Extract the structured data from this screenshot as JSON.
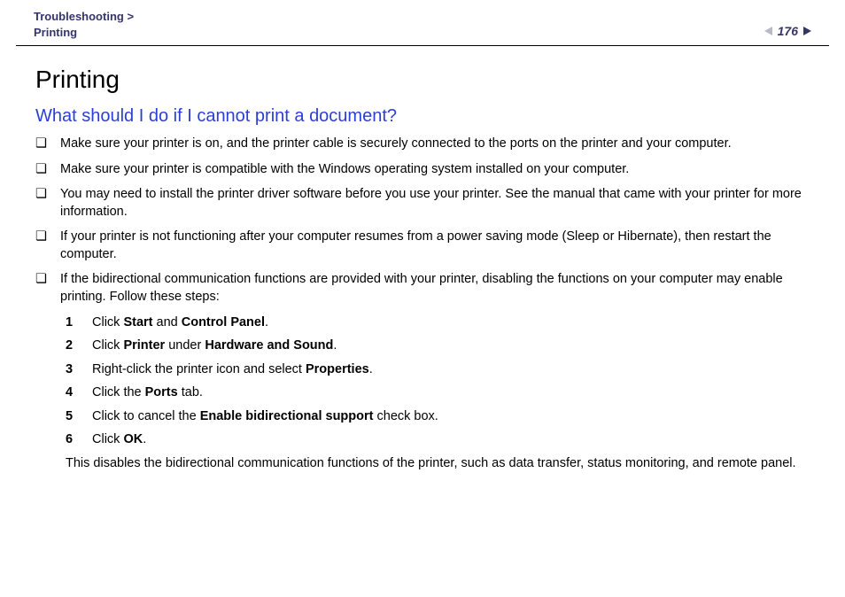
{
  "header": {
    "breadcrumb_top": "Troubleshooting",
    "breadcrumb_sep": ">",
    "breadcrumb_bottom": "Printing",
    "page_number": "176"
  },
  "content": {
    "title": "Printing",
    "subhead": "What should I do if I cannot print a document?",
    "bullets": [
      {
        "text": "Make sure your printer is on, and the printer cable is securely connected to the ports on the printer and your computer."
      },
      {
        "text": "Make sure your printer is compatible with the Windows operating system installed on your computer."
      },
      {
        "text": "You may need to install the printer driver software before you use your printer. See the manual that came with your printer for more information."
      },
      {
        "text": "If your printer is not functioning after your computer resumes from a power saving mode (Sleep or Hibernate), then restart the computer."
      },
      {
        "text": "If the bidirectional communication functions are provided with your printer, disabling the functions on your computer may enable printing. Follow these steps:"
      }
    ],
    "steps": [
      {
        "num": "1",
        "pre": "Click ",
        "b1": "Start",
        "mid": " and ",
        "b2": "Control Panel",
        "post": "."
      },
      {
        "num": "2",
        "pre": "Click ",
        "b1": "Printer",
        "mid": " under ",
        "b2": "Hardware and Sound",
        "post": "."
      },
      {
        "num": "3",
        "pre": "Right-click the printer icon and select ",
        "b1": "Properties",
        "mid": "",
        "b2": "",
        "post": "."
      },
      {
        "num": "4",
        "pre": "Click the ",
        "b1": "Ports",
        "mid": "",
        "b2": "",
        "post": " tab."
      },
      {
        "num": "5",
        "pre": "Click to cancel the ",
        "b1": "Enable bidirectional support",
        "mid": "",
        "b2": "",
        "post": " check box."
      },
      {
        "num": "6",
        "pre": "Click ",
        "b1": "OK",
        "mid": "",
        "b2": "",
        "post": "."
      }
    ],
    "after_steps": "This disables the bidirectional communication functions of the printer, such as data transfer, status monitoring, and remote panel."
  },
  "glyphs": {
    "bullet": "❏"
  }
}
